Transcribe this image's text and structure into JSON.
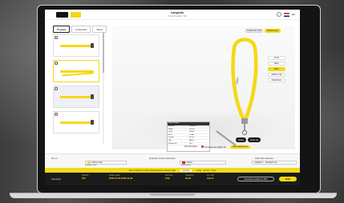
{
  "header": {
    "brand_label": "",
    "brand_badge": "",
    "title": "Lanyards",
    "subtitle": "Product editor / 3D",
    "language": "EN"
  },
  "tabs": [
    {
      "label": "Popular"
    },
    {
      "label": "Customize"
    },
    {
      "label": "Show"
    }
  ],
  "thumbnails": [
    {
      "index": "1"
    },
    {
      "index": "2"
    },
    {
      "index": "3"
    },
    {
      "index": "4"
    }
  ],
  "viewport": {
    "view_toggle_a": "Customise view",
    "view_toggle_b": "Default view",
    "options": [
      "Front",
      "Back",
      "Both",
      "Without clip",
      "Attachment"
    ],
    "selected_option": "Both",
    "sub_options": [
      "Without clips",
      "Lanyard clip 1"
    ],
    "rotate_button": "Rotate",
    "zoom_button": "Zoom out",
    "hint_a": "Add 3D product",
    "hint_b": "Print & preview graphic file",
    "hint_c": "Order sample here"
  },
  "spec_table": {
    "header": "Specifications",
    "rows": [
      [
        "Material",
        "Polyester"
      ],
      [
        "Width",
        "20 mm"
      ],
      [
        "Color",
        "Yellow"
      ],
      [
        "Print",
        "1 side"
      ],
      [
        "Length",
        "90 cm"
      ],
      [
        "Clip",
        "Metal"
      ],
      [
        "Safety lock",
        "Yes"
      ]
    ]
  },
  "config": {
    "section_label": "Go on",
    "sub_label": "Quantity & price calculator",
    "field_a_label": "Lanyard color",
    "field_a_value": "Yellow strap",
    "field_b_label": "Attachment",
    "field_b_value": "Classic",
    "field_c_label": "Add extra features",
    "field_c_value": "Carabiner - standard clip"
  },
  "banner": {
    "text": "Time to place an order and guarantee delivery date",
    "badge": "Quantity",
    "right_text": "4 day - 10 min - 5 sec"
  },
  "footer": {
    "summary_label": "Summary",
    "quantity_label": "Quantity",
    "quantity_value": "100",
    "date_label": "Delivery date",
    "date_from": "2026-10-05",
    "date_to": "2026-10-09",
    "unit_label": "Unit price",
    "unit_value": "0.89",
    "total_label": "Total price",
    "total_value": "89.00",
    "vat_label": "incl. VAT",
    "vat_value": "109.47",
    "download_button": "Download quotation in PDF",
    "order_button": "Order"
  },
  "colors": {
    "accent": "#f5d816",
    "dark": "#1b1b1b"
  }
}
